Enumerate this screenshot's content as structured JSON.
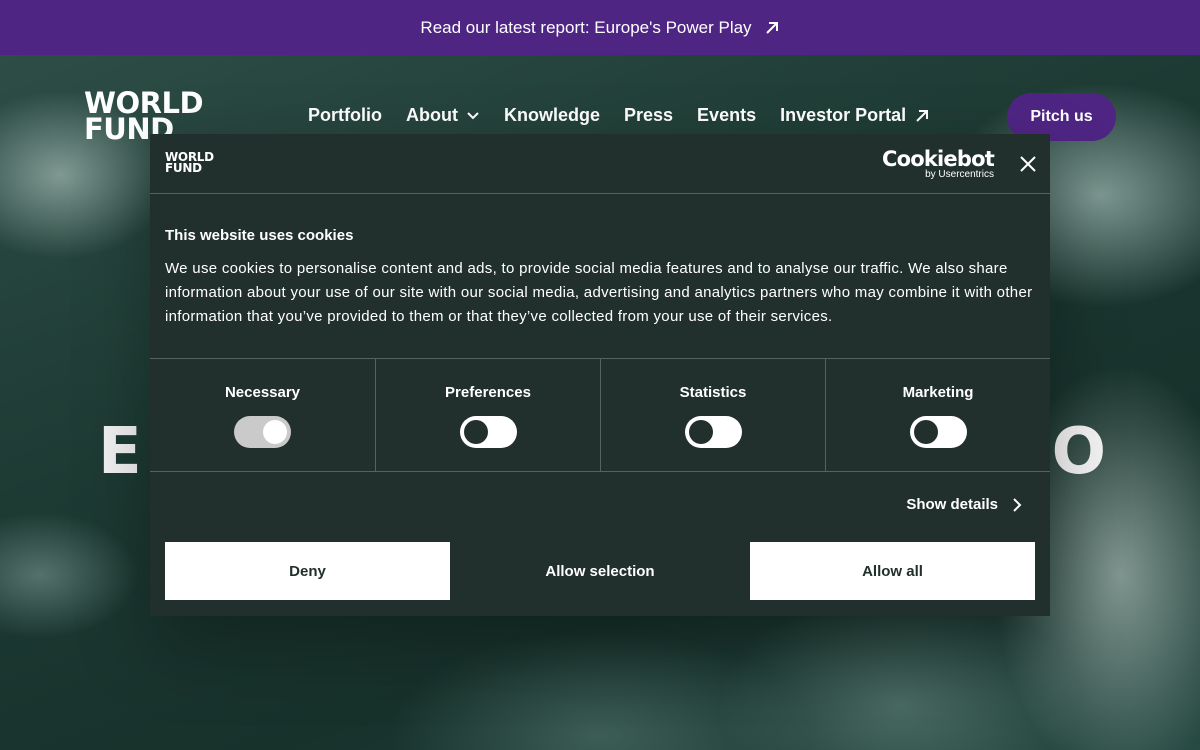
{
  "announcement": {
    "text": "Read our latest report: Europe's Power Play",
    "icon": "arrow-up-right-icon"
  },
  "nav": {
    "logo_line1": "WORLD",
    "logo_line2": "FUND",
    "links": [
      {
        "label": "Portfolio"
      },
      {
        "label": "About",
        "icon": "chevron-down-icon"
      },
      {
        "label": "Knowledge"
      },
      {
        "label": "Press"
      },
      {
        "label": "Events"
      },
      {
        "label": "Investor Portal",
        "icon": "arrow-up-right-icon"
      }
    ],
    "cta": "Pitch us"
  },
  "hero": {
    "left_fragment": "E",
    "right_fragment": "O"
  },
  "cookie_dialog": {
    "logo_line1": "WORLD",
    "logo_line2": "FUND",
    "brand": "Cookiebot",
    "brand_sub": "by Usercentrics",
    "title": "This website uses cookies",
    "body": "We use cookies to personalise content and ads, to provide social media features and to analyse our traffic. We also share information about your use of our site with our social media, advertising and analytics partners who may combine it with other information that you’ve provided to them or that they’ve collected from your use of their services.",
    "categories": [
      {
        "label": "Necessary",
        "checked": true
      },
      {
        "label": "Preferences",
        "checked": false
      },
      {
        "label": "Statistics",
        "checked": false
      },
      {
        "label": "Marketing",
        "checked": false
      }
    ],
    "show_details": "Show details",
    "buttons": {
      "deny": "Deny",
      "allow_selection": "Allow selection",
      "allow_all": "Allow all"
    }
  },
  "colors": {
    "purple": "#4f2584",
    "dialog_bg": "#22302d",
    "divider": "#56625f"
  }
}
